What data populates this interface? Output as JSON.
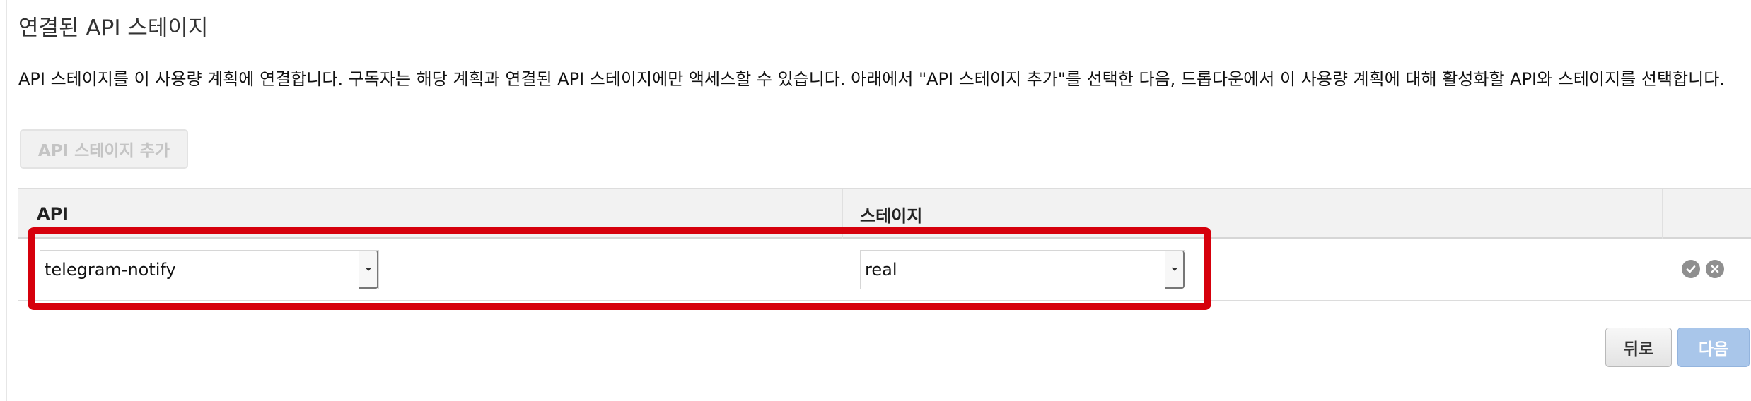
{
  "title": "연결된 API 스테이지",
  "description": "API 스테이지를 이 사용량 계획에 연결합니다. 구독자는 해당 계획과 연결된 API 스테이지에만 액세스할 수 있습니다. 아래에서 \"API 스테이지 추가\"를 선택한 다음, 드롭다운에서 이 사용량 계획에 대해 활성화할 API와 스테이지를 선택합니다.",
  "add_button_label": "API 스테이지 추가",
  "table": {
    "columns": [
      "API",
      "스테이지"
    ],
    "row": {
      "api_value": "telegram-notify",
      "stage_value": "real",
      "icons": [
        "check-circle-icon",
        "close-circle-icon"
      ]
    }
  },
  "footer": {
    "back_label": "뒤로",
    "next_label": "다음"
  },
  "colors": {
    "highlight": "#d6000c",
    "next_button": "#a9c6ea",
    "icon_gray": "#8f8f8f"
  }
}
